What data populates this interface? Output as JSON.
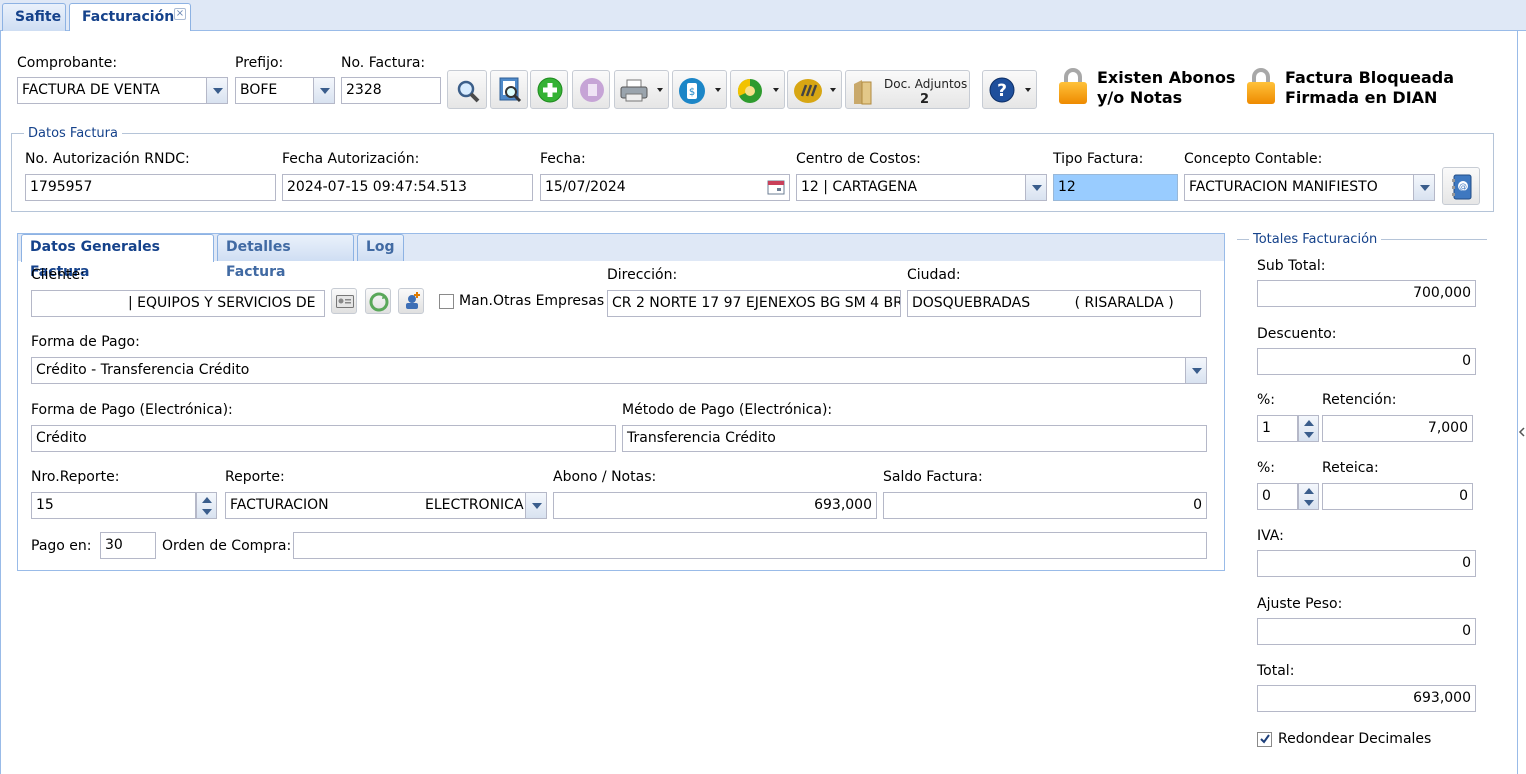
{
  "tabs": [
    {
      "label": "Safite"
    },
    {
      "label": "Facturación",
      "close": "×"
    }
  ],
  "header": {
    "comprobante_label": "Comprobante:",
    "comprobante_value": "FACTURA DE VENTA",
    "prefijo_label": "Prefijo:",
    "prefijo_value": "BOFE",
    "nofactura_label": "No. Factura:",
    "nofactura_value": "2328",
    "doc_adjuntos_label": "Doc. Adjuntos",
    "doc_adjuntos_count": "2",
    "abonos_line1": "Existen Abonos",
    "abonos_line2": "y/o Notas",
    "bloqueada_line1": "Factura Bloqueada",
    "bloqueada_line2": "Firmada en DIAN"
  },
  "datos_factura": {
    "legend": "Datos Factura",
    "rndc_label": "No. Autorización RNDC:",
    "rndc_value": "1795957",
    "fecha_aut_label": "Fecha Autorización:",
    "fecha_aut_value": "2024-07-15 09:47:54.513",
    "fecha_label": "Fecha:",
    "fecha_value": "15/07/2024",
    "centro_label": "Centro de Costos:",
    "centro_value": "12 | CARTAGENA",
    "tipo_label": "Tipo Factura:",
    "tipo_value": "12",
    "concepto_label": "Concepto Contable:",
    "concepto_value": "FACTURACION MANIFIESTO"
  },
  "subtabs": [
    {
      "label": "Datos Generales Factura"
    },
    {
      "label": "Detalles Factura"
    },
    {
      "label": "Log"
    }
  ],
  "general": {
    "cliente_label": "Cliente:",
    "cliente_value": "| EQUIPOS Y SERVICIOS DE",
    "man_otras_label": "Man.Otras Empresas",
    "direccion_label": "Dirección:",
    "direccion_value": "CR 2 NORTE 17 97 EJENEXOS BG SM 4 BRI",
    "ciudad_label": "Ciudad:",
    "ciudad_value": "DOSQUEBRADAS          ( RISARALDA )",
    "forma_pago_label": "Forma de Pago:",
    "forma_pago_value": "Crédito - Transferencia Crédito",
    "forma_pago_elec_label": "Forma de Pago (Electrónica):",
    "forma_pago_elec_value": "Crédito",
    "metodo_pago_label": "Método de Pago (Electrónica):",
    "metodo_pago_value": "Transferencia Crédito",
    "nro_reporte_label": "Nro.Reporte:",
    "nro_reporte_value": "15",
    "reporte_label": "Reporte:",
    "reporte_value_a": "FACTURACION",
    "reporte_value_b": "ELECTRONICA",
    "abono_label": "Abono / Notas:",
    "abono_value": "693,000",
    "saldo_label": "Saldo Factura:",
    "saldo_value": "0",
    "pago_en_label": "Pago en:",
    "pago_en_value": "30",
    "orden_label": "Orden de Compra:",
    "orden_value": ""
  },
  "totales": {
    "legend": "Totales Facturación",
    "subtotal_label": "Sub Total:",
    "subtotal_value": "700,000",
    "descuento_label": "Descuento:",
    "descuento_value": "0",
    "pct_label": "%:",
    "retencion_pct": "1",
    "retencion_label": "Retención:",
    "retencion_value": "7,000",
    "reteica_pct": "0",
    "reteica_label": "Reteica:",
    "reteica_value": "0",
    "iva_label": "IVA:",
    "iva_value": "0",
    "ajuste_label": "Ajuste Peso:",
    "ajuste_value": "0",
    "total_label": "Total:",
    "total_value": "693,000",
    "redondear_label": "Redondear Decimales",
    "redondear_checked": true
  }
}
